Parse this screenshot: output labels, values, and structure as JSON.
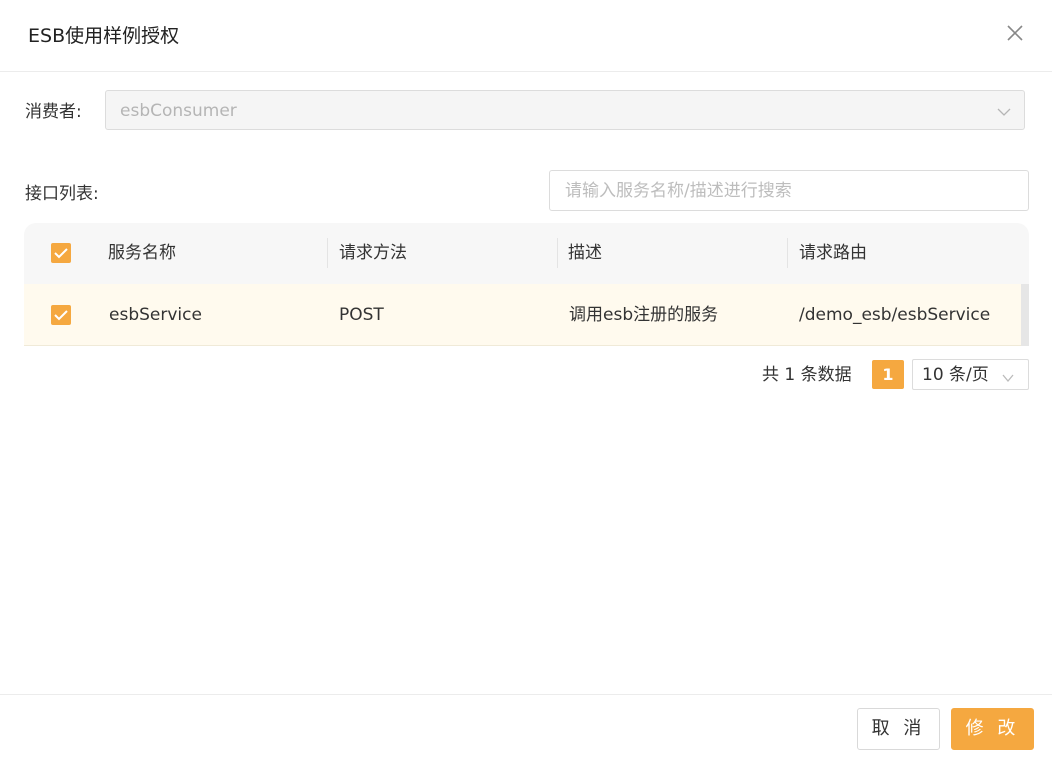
{
  "dialog": {
    "title": "ESB使用样例授权",
    "close_icon": "close-icon"
  },
  "consumer": {
    "label": "消费者:",
    "value": "esbConsumer",
    "chevron_icon": "chevron-down-icon"
  },
  "interface_list": {
    "label": "接口列表:",
    "search_placeholder": "请输入服务名称/描述进行搜索"
  },
  "table": {
    "columns": [
      "服务名称",
      "请求方法",
      "描述",
      "请求路由"
    ],
    "header_checked": true,
    "rows": [
      {
        "checked": true,
        "service_name": "esbService",
        "method": "POST",
        "description": "调用esb注册的服务",
        "route": "/demo_esb/esbService"
      }
    ]
  },
  "pagination": {
    "total_text": "共 1 条数据",
    "current_page": "1",
    "page_size": "10 条/页"
  },
  "footer": {
    "cancel_label": "取 消",
    "ok_label": "修 改"
  },
  "colors": {
    "accent": "#f5a840",
    "selected_row": "#fffaee",
    "header_bg": "#f7f7f7"
  }
}
